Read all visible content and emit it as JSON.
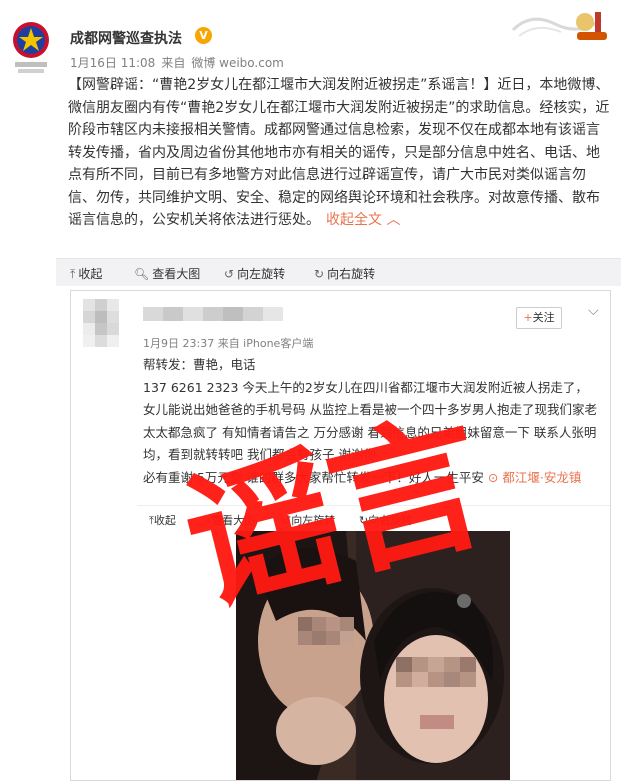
{
  "header": {
    "account_name": "成都网警巡查执法",
    "verified_mark": "V",
    "date": "1月16日 11:08",
    "source_prefix": "来自",
    "source": "微博 weibo.com"
  },
  "post": {
    "text": "【网警辟谣：“曹艳2岁女儿在都江堰市大润发附近被拐走”系谣言！】近日，本地微博、微信朋友圈内有传“曹艳2岁女儿在都江堰市大润发附近被拐走”的求助信息。经核实，近阶段市辖区内未接报相关警情。成都网警通过信息检索，发现不仅在成都本地有该谣言转发传播，省内及周边省份其他地市亦有相关的谣传，只是部分信息中姓名、电话、地点有所不同，目前已有多地警方对此信息进行过辟谣宣传，请广大市民对类似谣言勿信、勿传，共同维护文明、安全、稳定的网络舆论环境和社会秩序。对故意传播、散布谣言信息的，公安机关将依法进行惩处。",
    "expand_label": "收起全文",
    "expand_icon": "chevron-up-icon"
  },
  "toolbar": {
    "collapse": "收起",
    "view_large": "查看大图",
    "rotate_left": "向左旋转",
    "rotate_right": "向右旋转"
  },
  "embedded": {
    "meta": "1月9日 23:37 来自 iPhone客户端",
    "follow_label": "关注",
    "text_main": "帮转发：曹艳，电话\n137 6261 2323 今天上午的2岁女儿在四川省都江堰市大润发附近被人拐走了，女儿能说出她爸爸的手机号码 从监控上看是被一个四十多岁男人抱走了现我们家老太太都急疯了 有知情者请告之 万分感谢 看到信息的兄弟姐妹留意一下 联系人张明均，看到就转转吧 我们都会有孩子 谢谢你\n必有重谢 5万元整 谁的群多大家帮忙转发一下！好",
    "text_hidden_suffix": "人一生平安",
    "location": "都江堰·安龙镇",
    "toolbar": {
      "collapse": "收起",
      "view_large": "查看大图",
      "rotate_left": "向左旋转",
      "rotate_right": "向右旋转"
    }
  },
  "stamp": {
    "text": "谣言",
    "color": "#ff1a12"
  },
  "colors": {
    "accent_orange": "#eb7350",
    "verified_gold": "#f7a600",
    "toolbar_bg": "#f2f2f5"
  }
}
